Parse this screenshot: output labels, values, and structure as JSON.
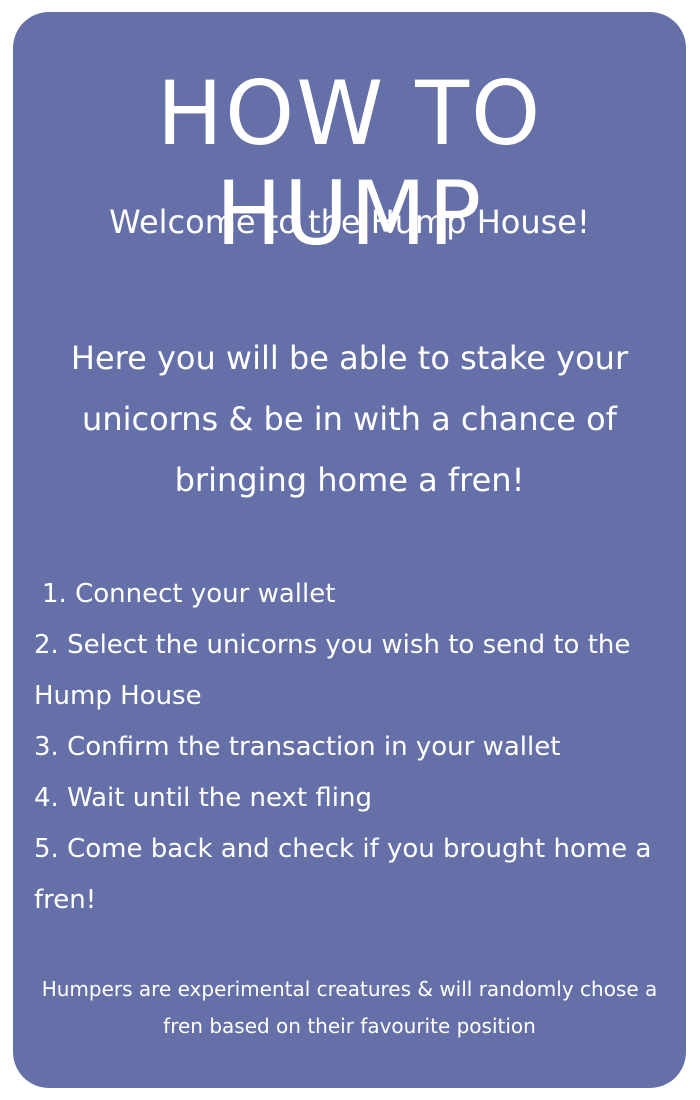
{
  "card": {
    "title": "HOW TO HUMP",
    "welcome": "Welcome to the Hump House!",
    "intro": "Here you will be able to stake your unicorns & be in with a chance of bringing home a fren!",
    "steps": [
      "1. Connect your wallet",
      "2. Select the unicorns you wish to send to the Hump House",
      "3. Confirm the transaction in your wallet",
      "4. Wait until the next fling",
      "5. Come back and check if you brought home a fren!"
    ],
    "footnote": "Humpers are experimental creatures & will randomly chose a fren based on their favourite position"
  },
  "colors": {
    "card_background": "#6670a8",
    "text": "#ffffff",
    "page_background": "#ffffff"
  }
}
